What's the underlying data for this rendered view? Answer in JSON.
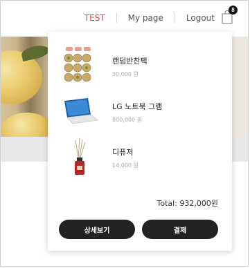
{
  "header": {
    "nav_test": "TEST",
    "nav_mypage": "My page",
    "nav_logout": "Logout",
    "cart_count": "8",
    "cart_icon": "shopping-bag-icon"
  },
  "cart": {
    "items": [
      {
        "name": "랜덤반찬팩",
        "price": "30,000 원",
        "thumb_icon": "side-dish-pack-image"
      },
      {
        "name": "LG 노트북 그램",
        "price": "800,000 원",
        "thumb_icon": "laptop-image"
      },
      {
        "name": "디퓨저",
        "price": "14,000 원",
        "thumb_icon": "diffuser-image"
      }
    ],
    "total": "Total: 932,000원",
    "detail_button": "상세보기",
    "pay_button": "결제"
  },
  "colors": {
    "accent_red": "#e0403b",
    "button_dark": "#222222"
  }
}
